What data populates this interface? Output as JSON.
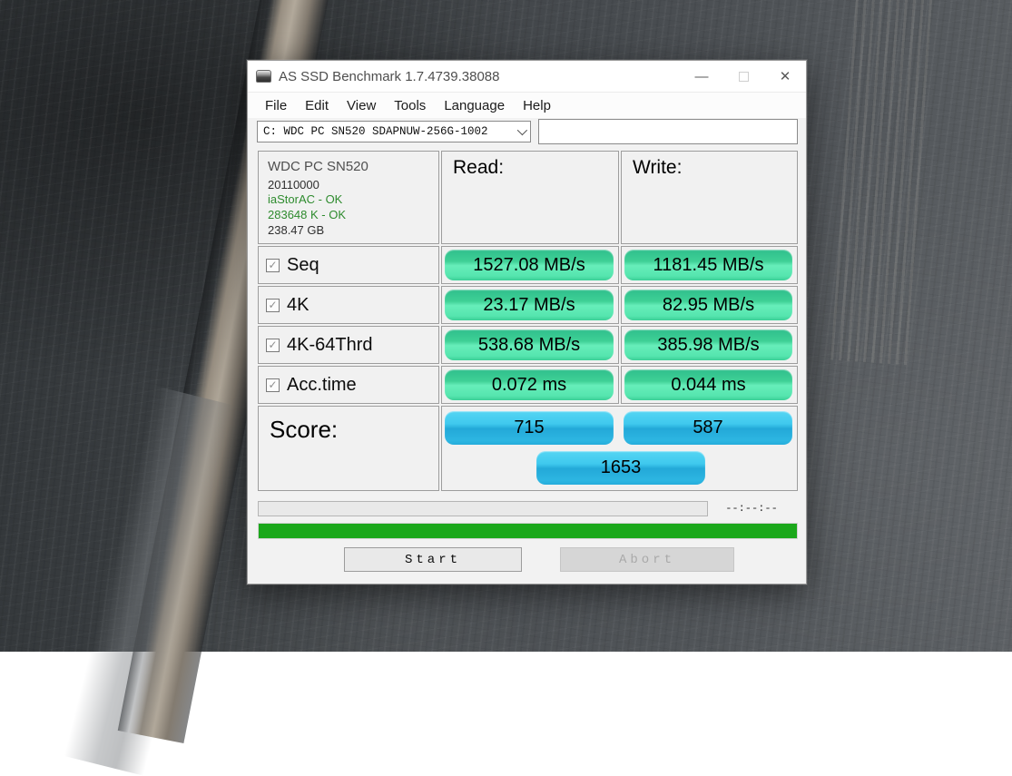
{
  "window": {
    "title": "AS SSD Benchmark 1.7.4739.38088",
    "minimize_glyph": "—",
    "close_glyph": "✕"
  },
  "menu": {
    "items": [
      "File",
      "Edit",
      "View",
      "Tools",
      "Language",
      "Help"
    ]
  },
  "drive_select": {
    "value": "C: WDC PC SN520 SDAPNUW-256G-1002"
  },
  "target_input": {
    "value": ""
  },
  "drive_info": {
    "model": "WDC PC SN520",
    "firmware": "20110000",
    "driver_status": "iaStorAC - OK",
    "offset_status": "283648 K - OK",
    "capacity": "238.47 GB"
  },
  "columns": {
    "read": "Read:",
    "write": "Write:"
  },
  "tests": [
    {
      "label": "Seq",
      "checked": true,
      "read": "1527.08 MB/s",
      "write": "1181.45 MB/s"
    },
    {
      "label": "4K",
      "checked": true,
      "read": "23.17 MB/s",
      "write": "82.95 MB/s"
    },
    {
      "label": "4K-64Thrd",
      "checked": true,
      "read": "538.68 MB/s",
      "write": "385.98 MB/s"
    },
    {
      "label": "Acc.time",
      "checked": true,
      "read": "0.072 ms",
      "write": "0.044 ms"
    }
  ],
  "score": {
    "label": "Score:",
    "read": "715",
    "write": "587",
    "total": "1653"
  },
  "progress": {
    "time_remaining": "--:--:--"
  },
  "buttons": {
    "start": "Start",
    "abort": "Abort"
  },
  "colors": {
    "pill_green": "#3fd096",
    "pill_blue": "#2fbfe8",
    "progress_green": "#1ba81b",
    "status_text_green": "#2e8b2e"
  }
}
